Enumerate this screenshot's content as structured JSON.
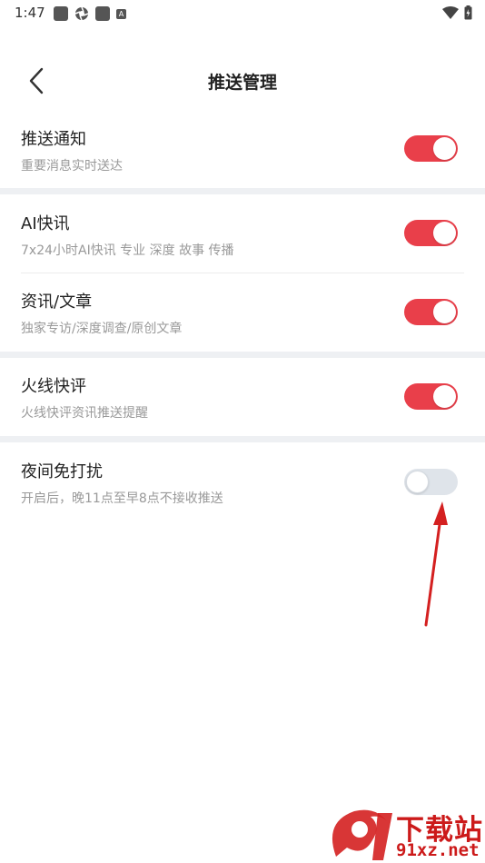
{
  "status_bar": {
    "time": "1:47",
    "badge": "A"
  },
  "header": {
    "title": "推送管理"
  },
  "settings": [
    {
      "title": "推送通知",
      "subtitle": "重要消息实时送达",
      "enabled": true
    },
    {
      "title": "AI快讯",
      "subtitle": "7x24小时AI快讯 专业 深度 故事 传播",
      "enabled": true
    },
    {
      "title": "资讯/文章",
      "subtitle": "独家专访/深度调查/原创文章",
      "enabled": true
    },
    {
      "title": "火线快评",
      "subtitle": "火线快评资讯推送提醒",
      "enabled": true
    },
    {
      "title": "夜间免打扰",
      "subtitle": "开启后，晚11点至早8点不接收推送",
      "enabled": false
    }
  ],
  "watermark": {
    "line1": "下载站",
    "line2": "91xz.net"
  },
  "colors": {
    "accent": "#e93f4a",
    "toggle_off": "#dfe4ea",
    "section_gap": "#eef0f3",
    "arrow": "#d42020"
  }
}
